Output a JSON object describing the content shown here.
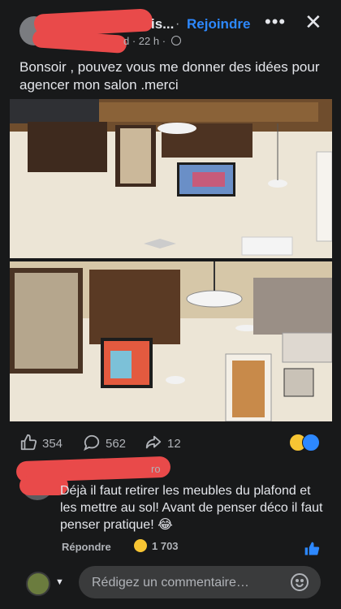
{
  "header": {
    "group_name": "is...",
    "separator": "·",
    "join_label": "Rejoindre",
    "more_icon": "more-horizontal-icon",
    "close_icon": "close-icon",
    "meta_prefix": "d",
    "time": "· 22 h ·",
    "privacy_icon": "globe-icon"
  },
  "post": {
    "text": "Bonsoir , pouvez vous me donner des idées pour agencer mon salon .merci"
  },
  "stats": {
    "likes": "354",
    "comments": "562",
    "shares": "12",
    "reaction_icons": [
      "haha-icon",
      "like-icon"
    ]
  },
  "comment": {
    "author_suffix": "ro",
    "text": "Déjà il faut retirer les meubles du plafond et les mettre au sol! Avant de penser déco il faut penser pratique! 😂",
    "reply_label": "Répondre",
    "reaction_count": "1 703"
  },
  "composer": {
    "placeholder": "Rédigez un commentaire…"
  },
  "colors": {
    "background": "#18191a",
    "accent": "#2d88ff",
    "redaction": "#e94a4a"
  }
}
